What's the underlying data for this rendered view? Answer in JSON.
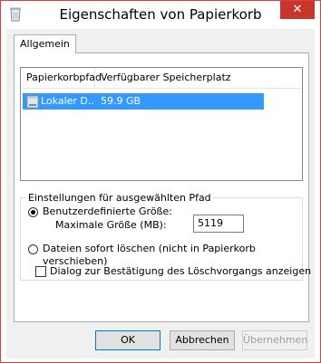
{
  "window": {
    "title": "Eigenschaften von Papierkorb",
    "close_glyph": "✕"
  },
  "tabs": [
    {
      "label": "Allgemein"
    }
  ],
  "listview": {
    "columns": [
      "Papierkorbpfad",
      "Verfügbarer Speicherplatz"
    ],
    "rows": [
      {
        "path": "Lokaler D...",
        "space": "59.9 GB",
        "selected": true,
        "icon": "drive-icon"
      }
    ]
  },
  "settings": {
    "group_label": "Einstellungen für ausgewählten Pfad",
    "option_custom": "Benutzerdefinierte Größe:",
    "max_size_label": "Maximale Größe (MB):",
    "max_size_value": "5119",
    "option_delete_line1": "Dateien sofort löschen (nicht in Papierkorb",
    "option_delete_line2": "verschieben)",
    "selected_option": "custom"
  },
  "confirm_checkbox": {
    "label": "Dialog zur Bestätigung des Löschvorgangs anzeigen",
    "checked": false
  },
  "buttons": {
    "ok": "OK",
    "cancel": "Abbrechen",
    "apply": "Übernehmen"
  },
  "colors": {
    "selection": "#3399ff",
    "close": "#c7362b",
    "border_accent": "#e53935"
  }
}
